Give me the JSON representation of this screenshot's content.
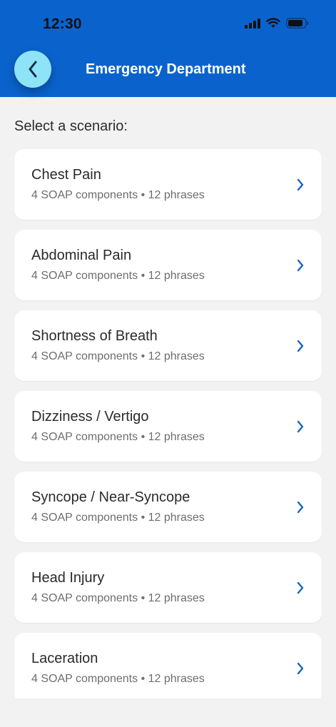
{
  "status_bar": {
    "time": "12:30",
    "icons": [
      "cellular-signal-icon",
      "wifi-icon",
      "battery-icon"
    ]
  },
  "header": {
    "title": "Emergency Department",
    "back_icon": "chevron-left-icon"
  },
  "section_label": "Select a scenario:",
  "scenarios": [
    {
      "title": "Chest Pain",
      "subtitle": "4 SOAP components • 12 phrases"
    },
    {
      "title": "Abdominal Pain",
      "subtitle": "4 SOAP components • 12 phrases"
    },
    {
      "title": "Shortness of Breath",
      "subtitle": "4 SOAP components • 12 phrases"
    },
    {
      "title": "Dizziness / Vertigo",
      "subtitle": "4 SOAP components • 12 phrases"
    },
    {
      "title": "Syncope / Near-Syncope",
      "subtitle": "4 SOAP components • 12 phrases"
    },
    {
      "title": "Head Injury",
      "subtitle": "4 SOAP components • 12 phrases"
    },
    {
      "title": "Laceration",
      "subtitle": "4 SOAP components • 12 phrases"
    }
  ],
  "colors": {
    "header": "#0a63cd",
    "back_button": "#8fe3f7",
    "background": "#f2f2f3",
    "chevron": "#1565c0"
  }
}
